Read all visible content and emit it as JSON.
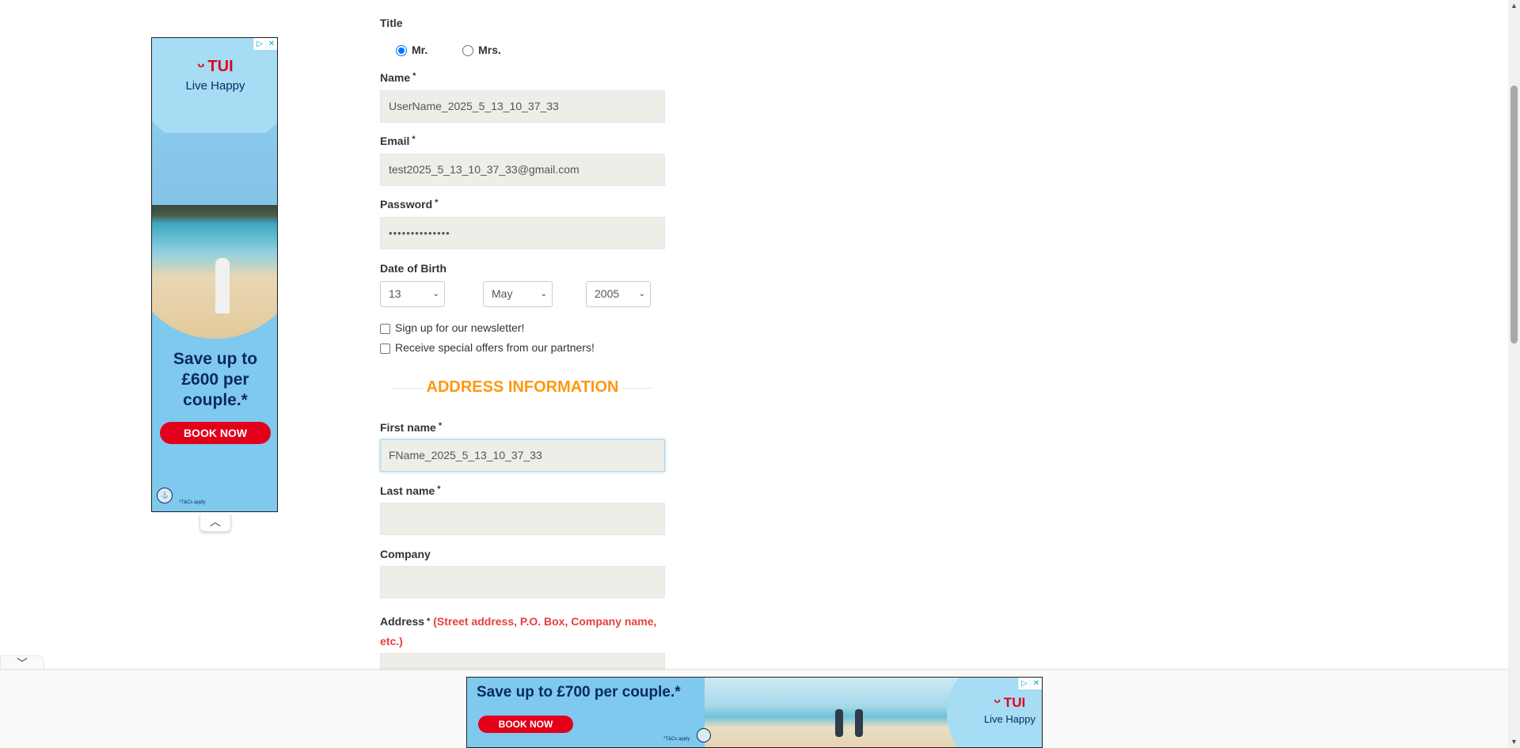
{
  "form": {
    "title_label": "Title",
    "title_options": [
      {
        "label": "Mr.",
        "checked": true
      },
      {
        "label": "Mrs.",
        "checked": false
      }
    ],
    "name": {
      "label": "Name",
      "required": "*",
      "value": "UserName_2025_5_13_10_37_33"
    },
    "email": {
      "label": "Email",
      "required": "*",
      "value": "test2025_5_13_10_37_33@gmail.com"
    },
    "password": {
      "label": "Password",
      "required": "*",
      "value": "••••••••••••••"
    },
    "dob": {
      "label": "Date of Birth",
      "day": "13",
      "month": "May",
      "year": "2005"
    },
    "newsletter_label": "Sign up for our newsletter!",
    "offers_label": "Receive special offers from our partners!",
    "address_section_title": "ADDRESS INFORMATION",
    "first_name": {
      "label": "First name",
      "required": "*",
      "value": "FName_2025_5_13_10_37_33"
    },
    "last_name": {
      "label": "Last name",
      "required": "*",
      "value": ""
    },
    "company": {
      "label": "Company",
      "value": ""
    },
    "address": {
      "label": "Address",
      "required": "*",
      "hint_line1": "(Street address, P.O. Box, Company name,",
      "hint_line2": "etc.)",
      "value": ""
    }
  },
  "ad_left": {
    "brand": "TUI",
    "tagline": "Live Happy",
    "headline_line1": "Save up to",
    "headline_line2": "£600 per",
    "headline_line3": "couple.*",
    "cta": "BOOK NOW",
    "terms": "*T&Cs apply"
  },
  "ad_bottom": {
    "headline": "Save up to £700 per couple.*",
    "cta": "BOOK NOW",
    "terms": "*T&Cs apply",
    "brand": "TUI",
    "tagline": "Live Happy"
  },
  "colors": {
    "accent_orange": "#fe980f",
    "hint_red": "#e83e3e",
    "tui_red": "#e2001a",
    "tui_navy": "#092a5e",
    "input_bg": "#eeede8"
  }
}
